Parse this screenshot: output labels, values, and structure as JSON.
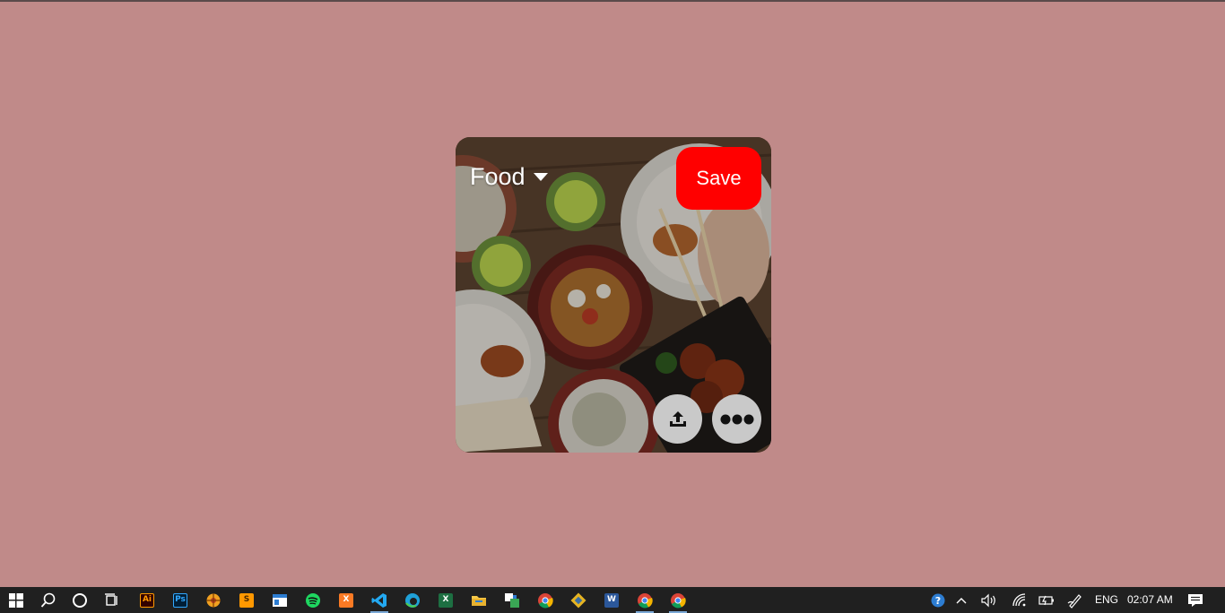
{
  "pin": {
    "board_name": "Food",
    "save_label": "Save",
    "accent_color": "#ff0000"
  },
  "taskbar": {
    "apps": [
      {
        "name": "start",
        "icon": "windows-logo-icon"
      },
      {
        "name": "search",
        "icon": "search-icon"
      },
      {
        "name": "cortana",
        "icon": "circle-icon"
      },
      {
        "name": "task-view",
        "icon": "task-view-icon"
      },
      {
        "name": "illustrator",
        "icon": "illustrator-icon",
        "glyph": "Ai"
      },
      {
        "name": "photoshop",
        "icon": "photoshop-icon",
        "glyph": "Ps"
      },
      {
        "name": "app-orange",
        "icon": "compass-icon"
      },
      {
        "name": "sublime",
        "icon": "sublime-text-icon",
        "glyph": "S"
      },
      {
        "name": "app-window",
        "icon": "window-app-icon"
      },
      {
        "name": "spotify",
        "icon": "spotify-icon"
      },
      {
        "name": "xampp",
        "icon": "xampp-icon",
        "glyph": "X"
      },
      {
        "name": "vscode",
        "icon": "vscode-icon"
      },
      {
        "name": "edge",
        "icon": "edge-icon"
      },
      {
        "name": "excel",
        "icon": "excel-icon",
        "glyph": "X"
      },
      {
        "name": "file-explorer",
        "icon": "folder-icon"
      },
      {
        "name": "app-green",
        "icon": "snipping-icon"
      },
      {
        "name": "chrome",
        "icon": "chrome-icon"
      },
      {
        "name": "git",
        "icon": "git-icon"
      },
      {
        "name": "word",
        "icon": "word-icon",
        "glyph": "W"
      },
      {
        "name": "chrome-2",
        "icon": "chrome-icon"
      },
      {
        "name": "chrome-3",
        "icon": "chrome-icon"
      }
    ],
    "tray": {
      "language": "ENG",
      "time": "02:07 AM"
    }
  }
}
